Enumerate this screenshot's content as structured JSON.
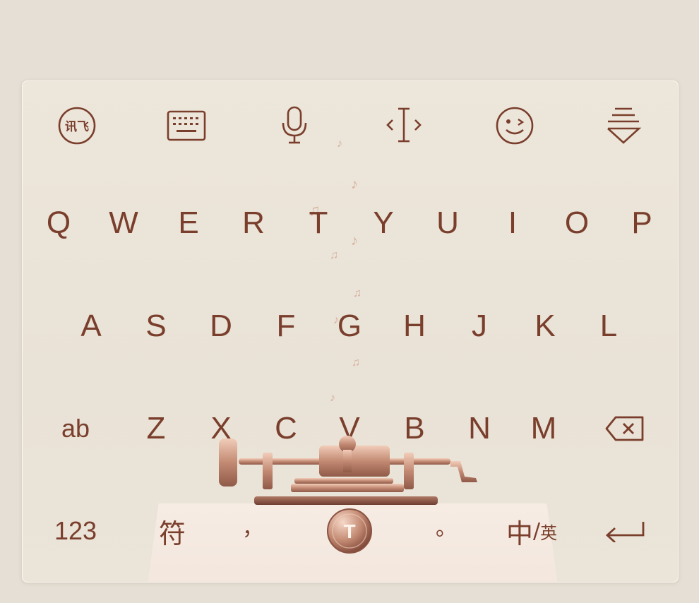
{
  "toolbar": {
    "items": [
      {
        "name": "ifly-logo-icon",
        "label": "讯飞"
      },
      {
        "name": "keyboard-icon"
      },
      {
        "name": "microphone-icon"
      },
      {
        "name": "cursor-move-icon"
      },
      {
        "name": "emoji-icon"
      },
      {
        "name": "collapse-keyboard-icon"
      }
    ]
  },
  "rows": {
    "row1": [
      "Q",
      "W",
      "E",
      "R",
      "T",
      "Y",
      "U",
      "I",
      "O",
      "P"
    ],
    "row2": [
      "A",
      "S",
      "D",
      "F",
      "G",
      "H",
      "J",
      "K",
      "L"
    ],
    "row3": {
      "shift_label": "ab",
      "letters": [
        "Z",
        "X",
        "C",
        "V",
        "B",
        "N",
        "M"
      ],
      "delete_icon": "backspace-icon"
    }
  },
  "bottom": {
    "numbers": "123",
    "symbols": "符",
    "comma": "，",
    "period": "。",
    "lang_main": "中",
    "lang_sep": "/",
    "lang_alt": "英",
    "enter_icon": "enter-icon",
    "space_icon": "phonograph-space-icon",
    "space_glyph": "T"
  },
  "colors": {
    "key_text": "#7a3e2c",
    "background": "#e9e2d6",
    "accent_rose_gold": "#c38a73"
  }
}
